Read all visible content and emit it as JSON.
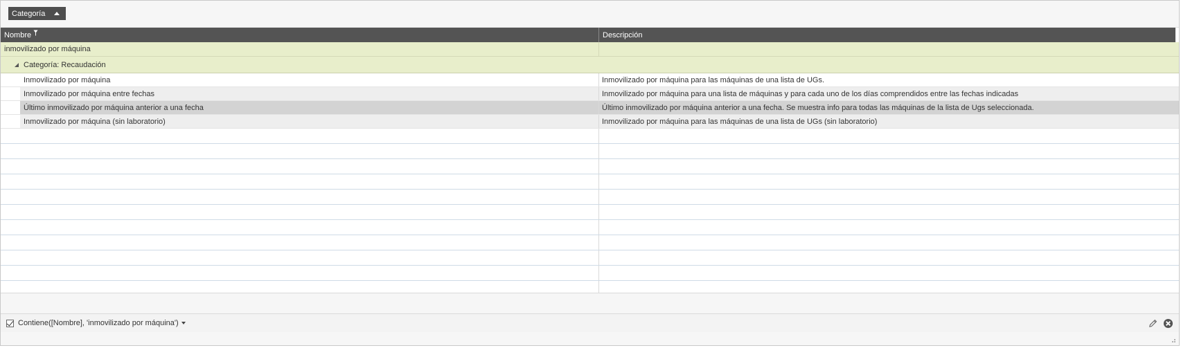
{
  "group_panel": {
    "chip_label": "Categoría"
  },
  "columns": {
    "name": "Nombre",
    "description": "Descripción"
  },
  "group": {
    "label": "inmovilizado por máquina",
    "category_label": "Categoría: Recaudación"
  },
  "rows": [
    {
      "name": "Inmovilizado por máquina",
      "description": "Inmovilizado por máquina para las máquinas de una lista de UGs."
    },
    {
      "name": "Inmovilizado por máquina entre fechas",
      "description": "Inmovilizado por máquina para una lista de máquinas y para cada uno de los días comprendidos entre las fechas indicadas"
    },
    {
      "name": "Último inmovilizado por máquina anterior a una fecha",
      "description": "Último inmovilizado por máquina anterior a una fecha. Se muestra info para todas las máquinas de la lista de Ugs seleccionada."
    },
    {
      "name": "Inmovilizado por máquina (sin laboratorio)",
      "description": "Inmovilizado por máquina para las máquinas de una lista de UGs (sin laboratorio)"
    }
  ],
  "filter": {
    "expression": "Contiene([Nombre], 'inmovilizado por máquina')"
  },
  "icons": {
    "filter": "filter-icon",
    "edit": "pencil-icon",
    "clear": "close-circle-icon",
    "expand": "expand-triangle-icon"
  },
  "colors": {
    "header_bg": "#545454",
    "group_row_bg": "#e8eecb",
    "selected_row_bg": "#d3d3d3"
  }
}
